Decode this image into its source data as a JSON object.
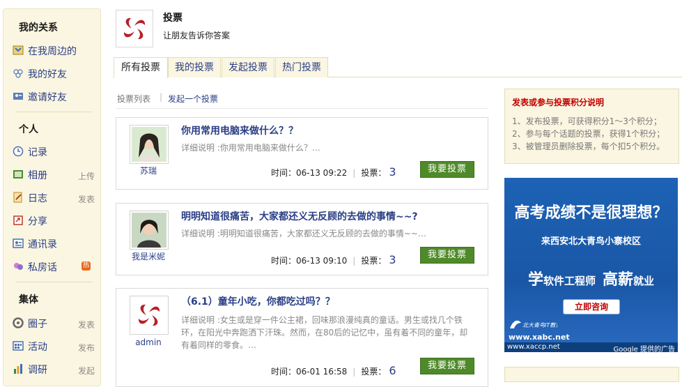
{
  "sidebar": {
    "group_relations": "我的关系",
    "relations": [
      {
        "label": "在我周边的",
        "icon": "map-icon"
      },
      {
        "label": "我的好友",
        "icon": "friends-icon"
      },
      {
        "label": "邀请好友",
        "icon": "invite-icon"
      }
    ],
    "group_personal": "个人",
    "personal": [
      {
        "label": "记录",
        "icon": "clock-icon",
        "extra": ""
      },
      {
        "label": "相册",
        "icon": "album-icon",
        "extra": "上传"
      },
      {
        "label": "日志",
        "icon": "journal-icon",
        "extra": "发表"
      },
      {
        "label": "分享",
        "icon": "share-icon",
        "extra": ""
      },
      {
        "label": "通讯录",
        "icon": "contacts-icon",
        "extra": ""
      },
      {
        "label": "私房话",
        "icon": "chat-icon",
        "extra": "",
        "badge": "热"
      }
    ],
    "group_collective": "集体",
    "collective": [
      {
        "label": "圈子",
        "icon": "circle-icon",
        "extra": "发表"
      },
      {
        "label": "活动",
        "icon": "activity-icon",
        "extra": "发布"
      },
      {
        "label": "调研",
        "icon": "survey-icon",
        "extra": "发起"
      }
    ]
  },
  "header": {
    "title": "投票",
    "subtitle": "让朋友告诉你答案"
  },
  "tabs": [
    "所有投票",
    "我的投票",
    "发起投票",
    "热门投票"
  ],
  "subnav": {
    "list": "投票列表",
    "create": "发起一个投票"
  },
  "polls": [
    {
      "author": "苏瑞",
      "title": "你用常用电脑来做什么？？",
      "desc": "详细说明 :你用常用电脑来做什么？…",
      "time": "时间：06-13 09:22",
      "votes_label": "投票：",
      "votes": "3",
      "button": "我要投票"
    },
    {
      "author": "我是米妮",
      "title": "明明知道很痛苦，大家都还义无反顾的去做的事情~~?",
      "desc": "详细说明 :明明知道很痛苦，大家都还义无反顾的去做的事情~~…",
      "time": "时间：06-13 09:10",
      "votes_label": "投票：",
      "votes": "3",
      "button": "我要投票"
    },
    {
      "author": "admin",
      "title": "（6.1）童年小吃，你都吃过吗？？",
      "desc": "详细说明 :女生或是穿一件公主裙，回味那浪漫纯真的童话。男生或找几个铁环，在阳光中奔跑洒下汗珠。然而，在80后的记忆中，虽有着不同的童年，却有着同样的零食。…",
      "time": "时间：06-01 16:58",
      "votes_label": "投票：",
      "votes": "6",
      "button": "我要投票"
    }
  ],
  "info": {
    "title": "发表或参与投票积分说明",
    "lines": [
      "1、发布投票，可获得积分1～3个积分；",
      "2、参与每个话题的投票，获得1个积分；",
      "3、被管理员删除投票，每个扣5个积分。"
    ]
  },
  "ad": {
    "headline": "高考成绩不是很理想？",
    "sub": "来西安北大青鸟小寨校区",
    "slogan_1": "学",
    "slogan_2": "软件工程师",
    "slogan_3": "高薪",
    "slogan_4": "就业",
    "button": "立即咨询",
    "logo_text": "北大青鸟IT教育",
    "site": "www.xabc.net",
    "footer_left": "www.xaccp.net",
    "footer_right": "Google 提供的广告"
  },
  "colors": {
    "link": "#2a3e86",
    "accent_red": "#c00000",
    "button_green": "#4f8a2a",
    "panel_bg": "#fbf6e1",
    "ad_blue": "#1d62b5"
  }
}
